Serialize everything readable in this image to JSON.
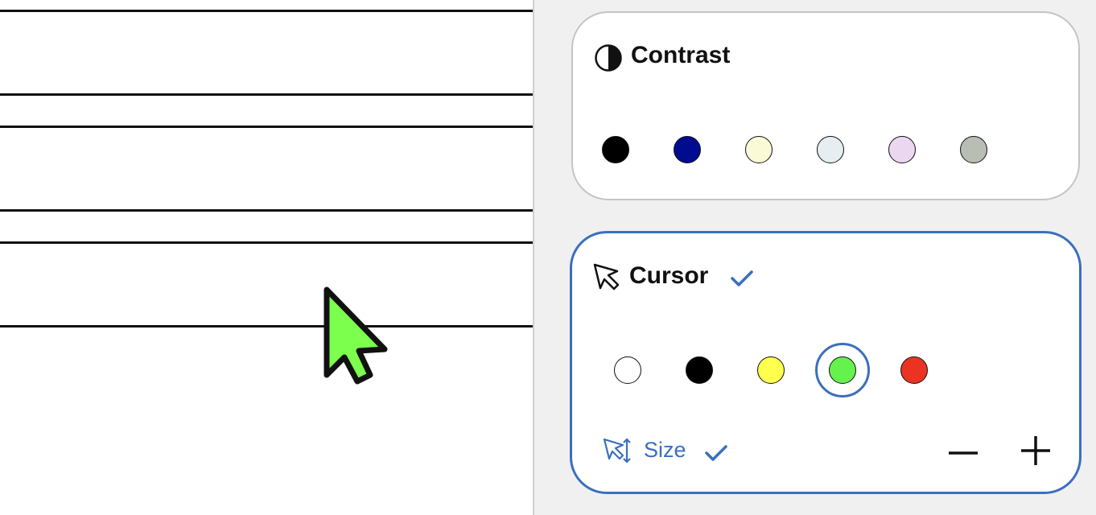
{
  "contrast": {
    "title": "Contrast",
    "icon": "contrast-icon",
    "swatches": [
      "#000000",
      "#000c8f",
      "#fafad7",
      "#e6eef2",
      "#ecd7f1",
      "#b8beb4"
    ]
  },
  "cursor": {
    "title": "Cursor",
    "icon": "cursor-icon",
    "enabled_check": "check-icon",
    "swatches": [
      "#ffffff",
      "#000000",
      "#ffff4d",
      "#66f24d",
      "#ea3323"
    ],
    "selected_color": "#66f24d",
    "size": {
      "label": "Size",
      "icon": "cursor-size-icon",
      "enabled_check": "check-icon",
      "decrease_icon": "minus-icon",
      "increase_icon": "plus-icon"
    }
  },
  "colors": {
    "accent": "#3a6fbf",
    "cursor_fill": "#7cff4d"
  }
}
